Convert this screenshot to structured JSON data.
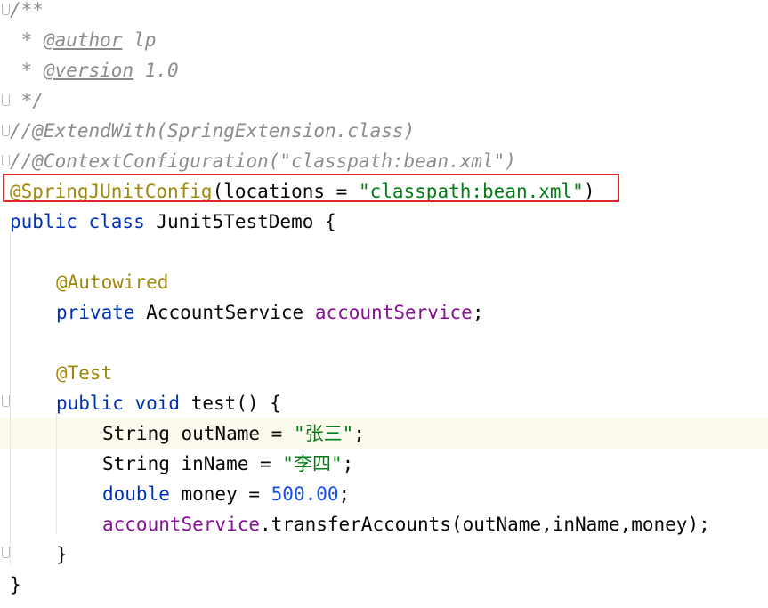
{
  "editor": {
    "lines": [
      {
        "id": "l1",
        "indent": 0,
        "tokens": [
          {
            "t": "/**",
            "s": "doc"
          }
        ]
      },
      {
        "id": "l2",
        "indent": 0,
        "tokens": [
          {
            "t": " * ",
            "s": "doc"
          },
          {
            "t": "@author",
            "s": "doctag"
          },
          {
            "t": " lp",
            "s": "doc"
          }
        ]
      },
      {
        "id": "l3",
        "indent": 0,
        "tokens": [
          {
            "t": " * ",
            "s": "doc"
          },
          {
            "t": "@version",
            "s": "doctag"
          },
          {
            "t": " 1.0",
            "s": "doc"
          }
        ]
      },
      {
        "id": "l4",
        "indent": 0,
        "tokens": [
          {
            "t": " */",
            "s": "doc"
          }
        ]
      },
      {
        "id": "l5",
        "indent": 0,
        "tokens": [
          {
            "t": "//@ExtendWith(SpringExtension.class)",
            "s": "doc"
          }
        ]
      },
      {
        "id": "l6",
        "indent": 0,
        "tokens": [
          {
            "t": "//@ContextConfiguration(\"classpath:bean.xml\")",
            "s": "doc"
          }
        ]
      },
      {
        "id": "l7",
        "indent": 0,
        "tokens": [
          {
            "t": "@SpringJUnitConfig",
            "s": "ann"
          },
          {
            "t": "(locations = ",
            "s": "plain"
          },
          {
            "t": "\"classpath:bean.xml\"",
            "s": "str"
          },
          {
            "t": ")",
            "s": "plain"
          }
        ]
      },
      {
        "id": "l8",
        "indent": 0,
        "tokens": [
          {
            "t": "public class",
            "s": "kw"
          },
          {
            "t": " Junit5TestDemo {",
            "s": "plain"
          }
        ]
      },
      {
        "id": "l9",
        "indent": 0,
        "tokens": []
      },
      {
        "id": "l10",
        "indent": 1,
        "tokens": [
          {
            "t": "@Autowired",
            "s": "ann"
          }
        ]
      },
      {
        "id": "l11",
        "indent": 1,
        "tokens": [
          {
            "t": "private",
            "s": "kw"
          },
          {
            "t": " AccountService ",
            "s": "plain"
          },
          {
            "t": "accountService",
            "s": "field"
          },
          {
            "t": ";",
            "s": "plain"
          }
        ]
      },
      {
        "id": "l12",
        "indent": 0,
        "tokens": []
      },
      {
        "id": "l13",
        "indent": 1,
        "tokens": [
          {
            "t": "@Test",
            "s": "ann"
          }
        ]
      },
      {
        "id": "l14",
        "indent": 1,
        "tokens": [
          {
            "t": "public void",
            "s": "kw"
          },
          {
            "t": " ",
            "s": "plain"
          },
          {
            "t": "test",
            "s": "plain"
          },
          {
            "t": "() {",
            "s": "plain"
          }
        ]
      },
      {
        "id": "l15",
        "indent": 2,
        "current": true,
        "tokens": [
          {
            "t": "String outName = ",
            "s": "plain"
          },
          {
            "t": "\"张三\"",
            "s": "str"
          },
          {
            "t": ";",
            "s": "plain"
          }
        ]
      },
      {
        "id": "l16",
        "indent": 2,
        "tokens": [
          {
            "t": "String inName = ",
            "s": "plain"
          },
          {
            "t": "\"李四\"",
            "s": "str"
          },
          {
            "t": ";",
            "s": "plain"
          }
        ]
      },
      {
        "id": "l17",
        "indent": 2,
        "tokens": [
          {
            "t": "double",
            "s": "kw"
          },
          {
            "t": " money = ",
            "s": "plain"
          },
          {
            "t": "500.00",
            "s": "num"
          },
          {
            "t": ";",
            "s": "plain"
          }
        ]
      },
      {
        "id": "l18",
        "indent": 2,
        "tokens": [
          {
            "t": "accountService",
            "s": "field"
          },
          {
            "t": ".transferAccounts(outName,inName,money);",
            "s": "plain"
          }
        ]
      },
      {
        "id": "l19",
        "indent": 1,
        "tokens": [
          {
            "t": "}",
            "s": "plain"
          }
        ]
      },
      {
        "id": "l20",
        "indent": 0,
        "tokens": [
          {
            "t": "}",
            "s": "plain"
          }
        ]
      }
    ]
  }
}
